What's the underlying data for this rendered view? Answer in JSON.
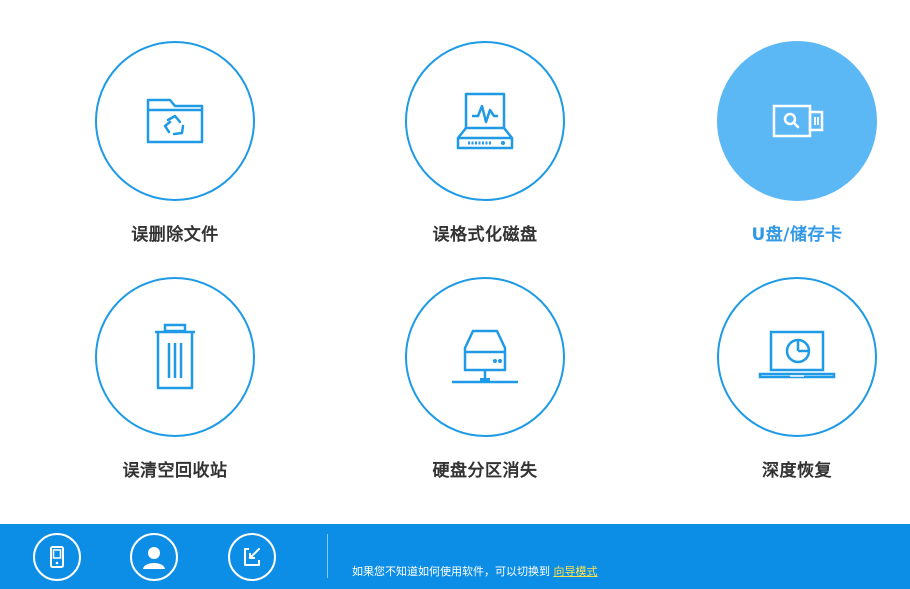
{
  "tiles": [
    {
      "label": "误删除文件",
      "icon": "folder-recycle-icon"
    },
    {
      "label": "误格式化磁盘",
      "icon": "disk-format-icon"
    },
    {
      "label": "U盘/储存卡",
      "icon": "usb-drive-icon"
    },
    {
      "label": "误清空回收站",
      "icon": "trash-bin-icon"
    },
    {
      "label": "硬盘分区消失",
      "icon": "hard-drive-icon"
    },
    {
      "label": "深度恢复",
      "icon": "laptop-icon"
    }
  ],
  "bottom_bar": {
    "tip_text": "如果您不知道如何使用软件，可以切换到",
    "tip_link": "向导模式",
    "icons": [
      "phone-icon",
      "user-icon",
      "share-icon"
    ]
  },
  "colors": {
    "accent": "#1e9ae6",
    "active_fill": "#5bb8f5",
    "bar": "#0d8ee6",
    "link": "#ffe14d"
  }
}
